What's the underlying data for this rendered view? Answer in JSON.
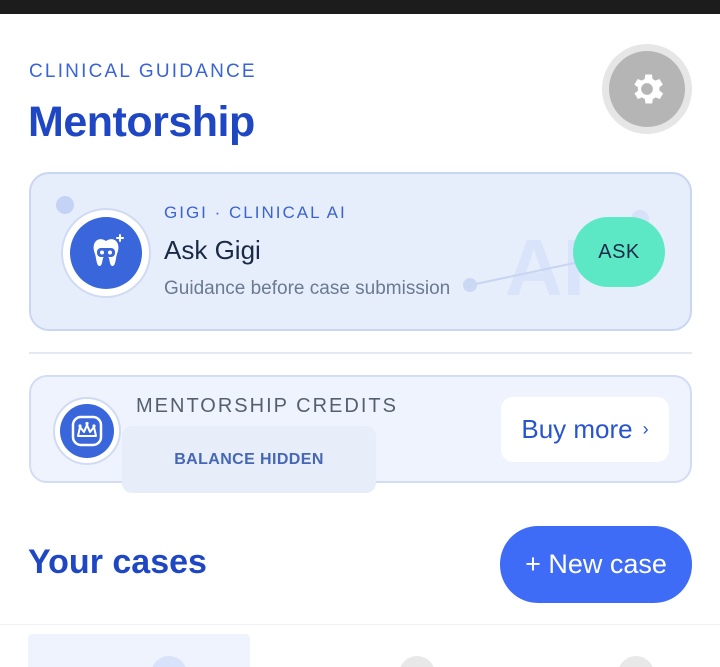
{
  "header": {
    "eyebrow": "CLINICAL GUIDANCE",
    "title": "Mentorship",
    "settings_icon": "gear-icon"
  },
  "ai_card": {
    "tag": "GIGI · CLINICAL AI",
    "title": "Ask Gigi",
    "subtitle": "Guidance before case submission",
    "button_label": "ASK",
    "watermark": "AI",
    "icon": "robot-tooth-icon",
    "button_color": "#5de8c5"
  },
  "credits": {
    "label": "MENTORSHIP CREDITS",
    "balance": "BALANCE HIDDEN",
    "buy_label": "Buy more",
    "buy_chevron": "›",
    "icon": "crown-icon"
  },
  "cases": {
    "title": "Your cases",
    "new_case_label": "+ New case",
    "button_color": "#3f6cf6"
  },
  "colors": {
    "brand": "#1f47c4",
    "accent": "#3a66dc"
  }
}
